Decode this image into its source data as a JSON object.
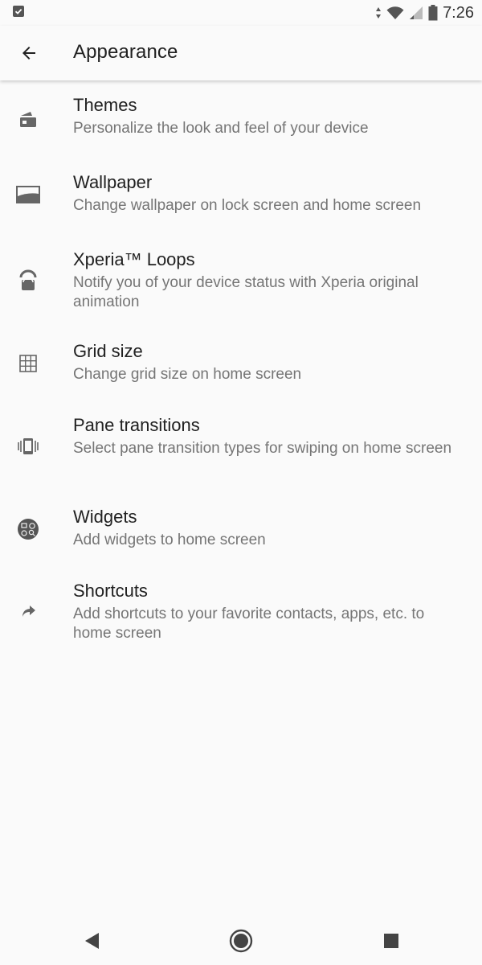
{
  "status_bar": {
    "time": "7:26"
  },
  "header": {
    "title": "Appearance"
  },
  "settings": [
    {
      "title": "Themes",
      "summary": "Personalize the look and feel of your device",
      "icon": "themes-icon"
    },
    {
      "title": "Wallpaper",
      "summary": "Change wallpaper on lock screen and home screen",
      "icon": "wallpaper-icon"
    },
    {
      "title": "Xperia™ Loops",
      "summary": "Notify you of your device status with Xperia original animation",
      "icon": "xperia-loops-icon"
    },
    {
      "title": "Grid size",
      "summary": "Change grid size on home screen",
      "icon": "grid-icon"
    },
    {
      "title": "Pane transitions",
      "summary": "Select pane transition types for swiping on home screen",
      "icon": "pane-transitions-icon"
    },
    {
      "title": "Widgets",
      "summary": "Add widgets to home screen",
      "icon": "widgets-icon"
    },
    {
      "title": "Shortcuts",
      "summary": "Add shortcuts to your favorite contacts, apps, etc. to home screen",
      "icon": "shortcut-arrow-icon"
    }
  ]
}
